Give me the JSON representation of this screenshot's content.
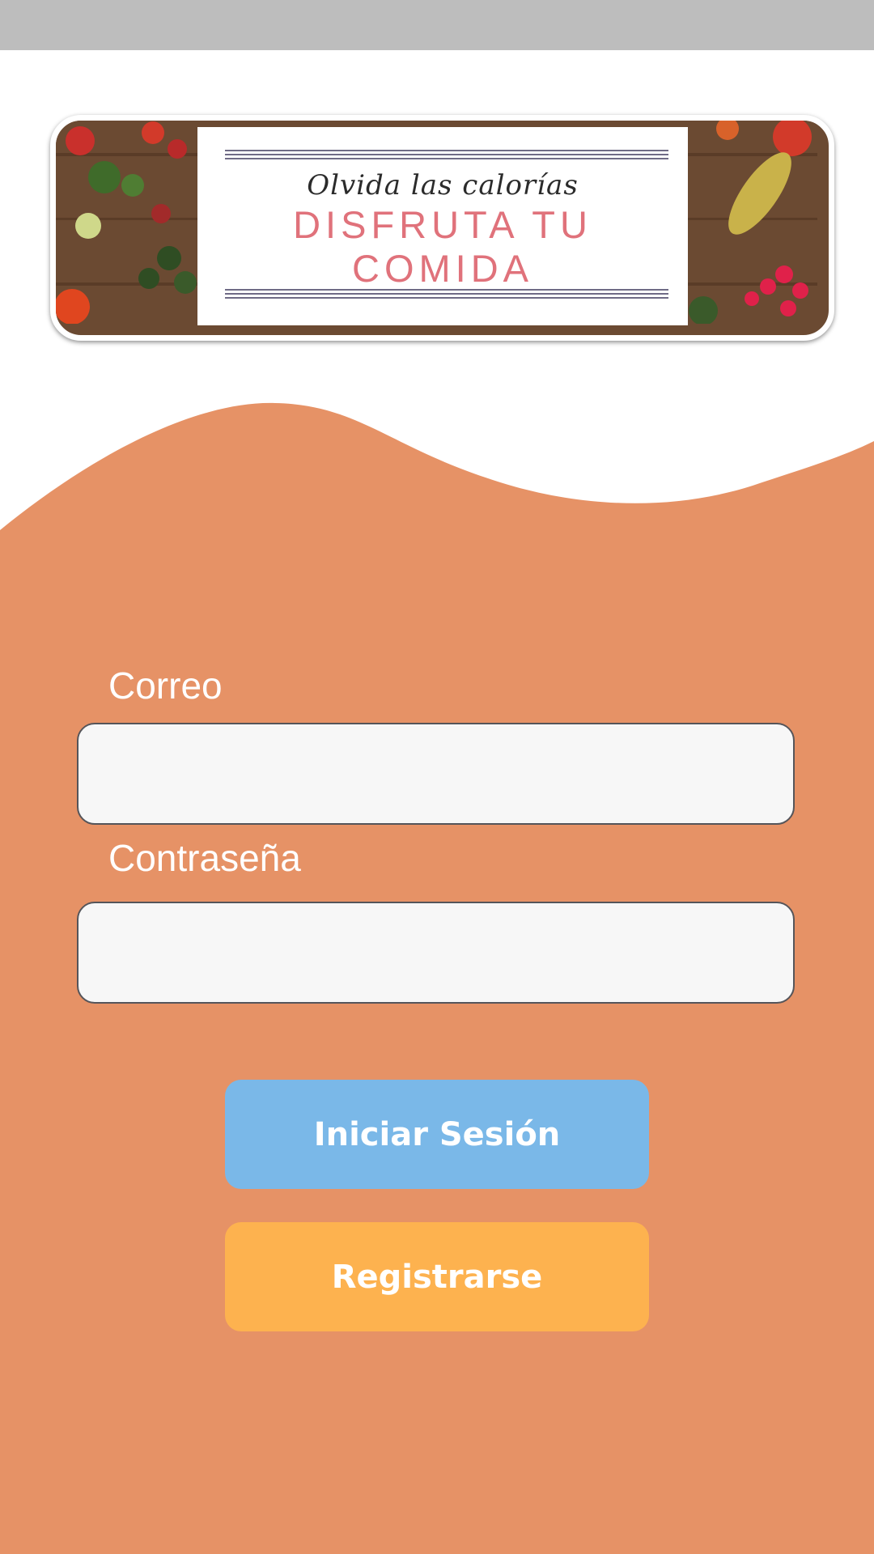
{
  "banner": {
    "script_text": "Olvida las calorías",
    "headline_line1": "DISFRUTA TU",
    "headline_line2": "COMIDA"
  },
  "login_form": {
    "email_label": "Correo",
    "email_value": "",
    "password_label": "Contraseña",
    "password_value": "",
    "login_button_label": "Iniciar Sesión",
    "register_button_label": "Registrarse"
  },
  "colors": {
    "background_accent": "#e69266",
    "login_button": "#7ab8e8",
    "register_button": "#fdb24f",
    "status_bar": "#bdbdbd",
    "banner_headline": "#e0727b"
  }
}
